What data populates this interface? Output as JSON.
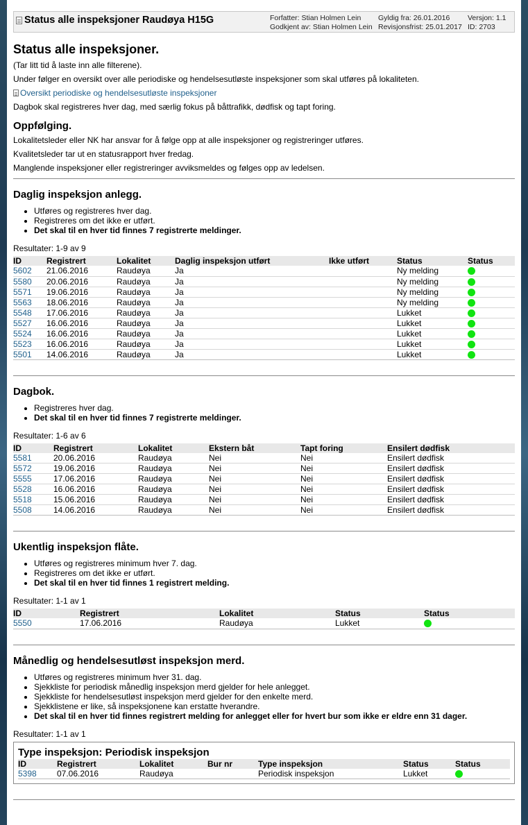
{
  "header": {
    "title": "Status alle inspeksjoner Raudøya H15G",
    "author": "Forfatter: Stian Holmen Lein",
    "approved": "Godkjent av: Stian Holmen Lein",
    "valid_from": "Gyldig fra: 26.01.2016",
    "revision": "Revisjonsfrist: 25.01.2017",
    "version": "Versjon: 1.1",
    "id": "ID: 2703"
  },
  "intro": {
    "heading": "Status alle inspeksjoner.",
    "p1": "(Tar litt tid å laste inn alle filterene).",
    "p2": "Under følger en oversikt over alle periodiske og hendelsesutløste inspeksjoner som skal utføres på lokaliteten.",
    "link": "Oversikt periodiske og hendelsesutløste inspeksjoner",
    "p3": "Dagbok skal registreres hver dag, med særlig fokus på båttrafikk, dødfisk og tapt foring."
  },
  "followup": {
    "heading": "Oppfølging.",
    "p1": "Lokalitetsleder eller NK har ansvar for å følge opp at alle inspeksjoner og registreringer utføres.",
    "p2": "Kvalitetsleder tar ut en statusrapport hver fredag.",
    "p3": "Manglende inspeksjoner eller registreringer avviksmeldes og følges opp av ledelsen."
  },
  "daily": {
    "heading": "Daglig inspeksjon anlegg.",
    "bullets": [
      "Utføres og registreres hver dag.",
      "Registreres om det ikke er utført."
    ],
    "bold_bullet": "Det skal til en hver tid finnes 7 registrerte meldinger.",
    "results": "Resultater: 1-9 av 9",
    "columns": [
      "ID",
      "Registrert",
      "Lokalitet",
      "Daglig inspeksjon utført",
      "Ikke utført",
      "Status",
      "Status"
    ],
    "rows": [
      [
        "5602",
        "21.06.2016",
        "Raudøya",
        "Ja",
        "",
        "Ny melding"
      ],
      [
        "5580",
        "20.06.2016",
        "Raudøya",
        "Ja",
        "",
        "Ny melding"
      ],
      [
        "5571",
        "19.06.2016",
        "Raudøya",
        "Ja",
        "",
        "Ny melding"
      ],
      [
        "5563",
        "18.06.2016",
        "Raudøya",
        "Ja",
        "",
        "Ny melding"
      ],
      [
        "5548",
        "17.06.2016",
        "Raudøya",
        "Ja",
        "",
        "Lukket"
      ],
      [
        "5527",
        "16.06.2016",
        "Raudøya",
        "Ja",
        "",
        "Lukket"
      ],
      [
        "5524",
        "16.06.2016",
        "Raudøya",
        "Ja",
        "",
        "Lukket"
      ],
      [
        "5523",
        "16.06.2016",
        "Raudøya",
        "Ja",
        "",
        "Lukket"
      ],
      [
        "5501",
        "14.06.2016",
        "Raudøya",
        "Ja",
        "",
        "Lukket"
      ]
    ]
  },
  "diary": {
    "heading": "Dagbok.",
    "bullets": [
      "Registreres hver dag."
    ],
    "bold_bullet": "Det skal til en hver tid finnes 7 registrerte meldinger.",
    "results": "Resultater: 1-6 av 6",
    "columns": [
      "ID",
      "Registrert",
      "Lokalitet",
      "Ekstern båt",
      "Tapt foring",
      "Ensilert dødfisk"
    ],
    "rows": [
      [
        "5581",
        "20.06.2016",
        "Raudøya",
        "Nei",
        "Nei",
        "Ensilert dødfisk"
      ],
      [
        "5572",
        "19.06.2016",
        "Raudøya",
        "Nei",
        "Nei",
        "Ensilert dødfisk"
      ],
      [
        "5555",
        "17.06.2016",
        "Raudøya",
        "Nei",
        "Nei",
        "Ensilert dødfisk"
      ],
      [
        "5528",
        "16.06.2016",
        "Raudøya",
        "Nei",
        "Nei",
        "Ensilert dødfisk"
      ],
      [
        "5518",
        "15.06.2016",
        "Raudøya",
        "Nei",
        "Nei",
        "Ensilert dødfisk"
      ],
      [
        "5508",
        "14.06.2016",
        "Raudøya",
        "Nei",
        "Nei",
        "Ensilert dødfisk"
      ]
    ]
  },
  "weekly": {
    "heading": "Ukentlig inspeksjon flåte.",
    "bullets": [
      "Utføres og registreres minimum hver 7. dag.",
      "Registreres om det ikke er utført."
    ],
    "bold_bullet": "Det skal til en hver tid finnes 1 registrert melding.",
    "results": "Resultater: 1-1 av 1",
    "columns": [
      "ID",
      "Registrert",
      "Lokalitet",
      "Status",
      "Status"
    ],
    "rows": [
      [
        "5550",
        "17.06.2016",
        "Raudøya",
        "Lukket"
      ]
    ]
  },
  "monthly": {
    "heading": "Månedlig og hendelsesutløst inspeksjon merd.",
    "bullets": [
      "Utføres og registreres minimum hver 31. dag.",
      "Sjekkliste for periodisk månedlig inspeksjon merd gjelder for hele anlegget.",
      "Sjekkliste for hendelsesutløst inspeksjon merd gjelder for den enkelte merd.",
      "Sjekklistene er like, så inspeksjonene kan erstatte hverandre."
    ],
    "bold_bullet": "Det skal til en hver tid finnes registrert melding for anlegget eller for hvert bur som ikke er eldre enn 31 dager.",
    "results": "Resultater: 1-1 av 1",
    "group_title": "Type inspeksjon: Periodisk inspeksjon",
    "columns": [
      "ID",
      "Registrert",
      "Lokalitet",
      "Bur nr",
      "Type inspeksjon",
      "Status",
      "Status"
    ],
    "rows": [
      [
        "5398",
        "07.06.2016",
        "Raudøya",
        "",
        "Periodisk inspeksjon",
        "Lukket"
      ]
    ]
  },
  "colors": {
    "status_ok": "#11e411",
    "link": "#1f5f8b"
  },
  "icons": {
    "document": "document-icon",
    "status": "status-dot-icon"
  }
}
